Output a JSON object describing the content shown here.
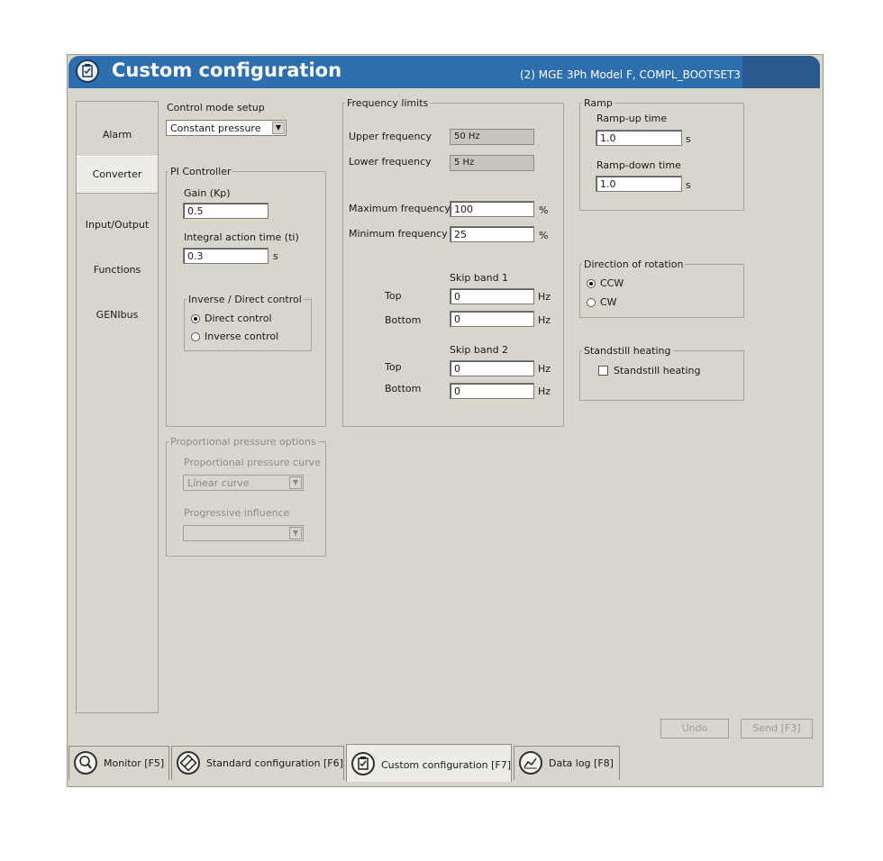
{
  "header": {
    "title": "Custom configuration",
    "subtitle": "(2) MGE 3Ph Model F, COMPL_BOOTSET3"
  },
  "sidebar": {
    "items": [
      {
        "label": "Alarm"
      },
      {
        "label": "Converter"
      },
      {
        "label": "Input/Output"
      },
      {
        "label": "Functions"
      },
      {
        "label": "GENIbus"
      }
    ],
    "selected": "Converter"
  },
  "control_mode": {
    "label": "Control mode setup",
    "value": "Constant pressure"
  },
  "pi_controller": {
    "legend": "PI Controller",
    "gain_label": "Gain (Kp)",
    "gain_value": "0.5",
    "integral_label": "Integral action time (ti)",
    "integral_value": "0.3",
    "integral_unit": "s",
    "inverse_direct": {
      "legend": "Inverse / Direct control",
      "options": [
        "Direct control",
        "Inverse control"
      ],
      "selected": "Direct control"
    }
  },
  "proportional_pressure": {
    "legend": "Proportional pressure options",
    "curve_label": "Proportional pressure curve",
    "curve_value": "Linear curve",
    "influence_label": "Progressive influence",
    "influence_value": ""
  },
  "frequency_limits": {
    "legend": "Frequency limits",
    "upper_label": "Upper frequency",
    "upper_value": "50 Hz",
    "lower_label": "Lower frequency",
    "lower_value": "5 Hz",
    "max_label": "Maximum frequency",
    "max_value": "100",
    "max_unit": "%",
    "min_label": "Minimum frequency",
    "min_value": "25",
    "min_unit": "%",
    "skip_band_1": {
      "title": "Skip band 1",
      "top_label": "Top",
      "top_value": "0",
      "bottom_label": "Bottom",
      "bottom_value": "0",
      "unit": "Hz"
    },
    "skip_band_2": {
      "title": "Skip band 2",
      "top_label": "Top",
      "top_value": "0",
      "bottom_label": "Bottom",
      "bottom_value": "0",
      "unit": "Hz"
    }
  },
  "ramp": {
    "legend": "Ramp",
    "up_label": "Ramp-up time",
    "up_value": "1.0",
    "down_label": "Ramp-down time",
    "down_value": "1.0",
    "unit": "s"
  },
  "direction": {
    "legend": "Direction of rotation",
    "options": [
      "CCW",
      "CW"
    ],
    "selected": "CCW"
  },
  "standstill": {
    "legend": "Standstill heating",
    "checkbox_label": "Standstill heating",
    "checked": false
  },
  "actions": {
    "undo_label": "Undo",
    "send_label": "Send [F3]"
  },
  "tabs": [
    {
      "label": "Monitor [F5]",
      "icon": "magnifier-icon"
    },
    {
      "label": "Standard configuration [F6]",
      "icon": "wrench-icon"
    },
    {
      "label": "Custom configuration [F7]",
      "icon": "clipboard-check-icon"
    },
    {
      "label": "Data log [F8]",
      "icon": "graph-icon"
    }
  ],
  "active_tab": "Custom configuration [F7]",
  "colors": {
    "title_bar": "#2d6fae",
    "panel": "#d8d5cc"
  }
}
